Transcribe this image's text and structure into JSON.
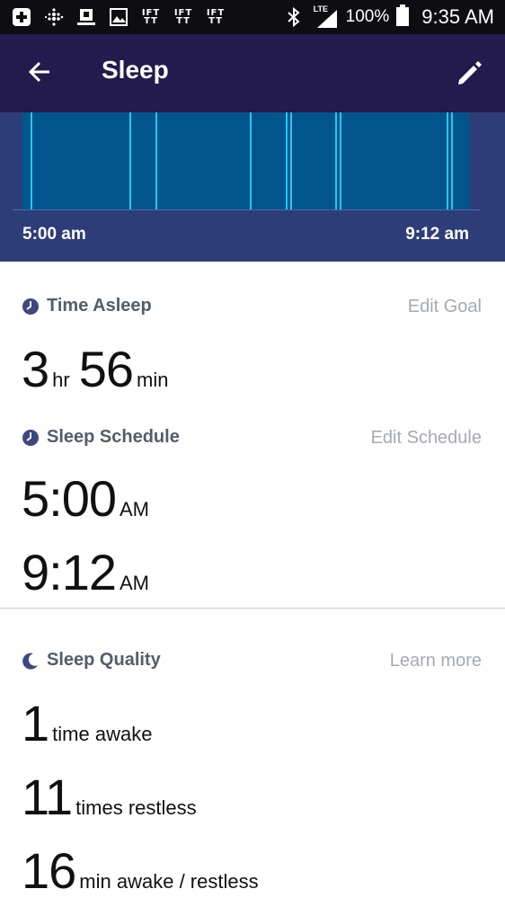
{
  "status_bar": {
    "lte": "LTE",
    "battery": "100%",
    "time": "9:35 AM",
    "ift_text": "IFT\nTT"
  },
  "header": {
    "title": "Sleep"
  },
  "chart": {
    "start_time": "5:00 am",
    "end_time": "9:12 am",
    "colors": {
      "bg": "#00558d",
      "line": "#26c7ef",
      "panel": "#2d3d78"
    },
    "events": [
      0.02,
      0.24,
      0.3,
      0.51,
      0.59,
      0.6,
      0.7,
      0.71,
      0.95,
      0.96
    ]
  },
  "time_asleep": {
    "label": "Time Asleep",
    "action": "Edit Goal",
    "hours": "3",
    "hours_unit": "hr",
    "minutes": "56",
    "minutes_unit": "min"
  },
  "schedule": {
    "label": "Sleep Schedule",
    "action": "Edit Schedule",
    "start": "5:00",
    "start_suffix": "AM",
    "end": "9:12",
    "end_suffix": "AM"
  },
  "quality": {
    "label": "Sleep Quality",
    "action": "Learn more",
    "items": [
      {
        "value": "1",
        "label": "time awake"
      },
      {
        "value": "11",
        "label": "times restless"
      },
      {
        "value": "16",
        "label": "min awake / restless"
      }
    ]
  },
  "colors": {
    "app_bar": "#231a4d",
    "status_bar": "#0e0e12",
    "icon_accent": "#3f4780"
  }
}
